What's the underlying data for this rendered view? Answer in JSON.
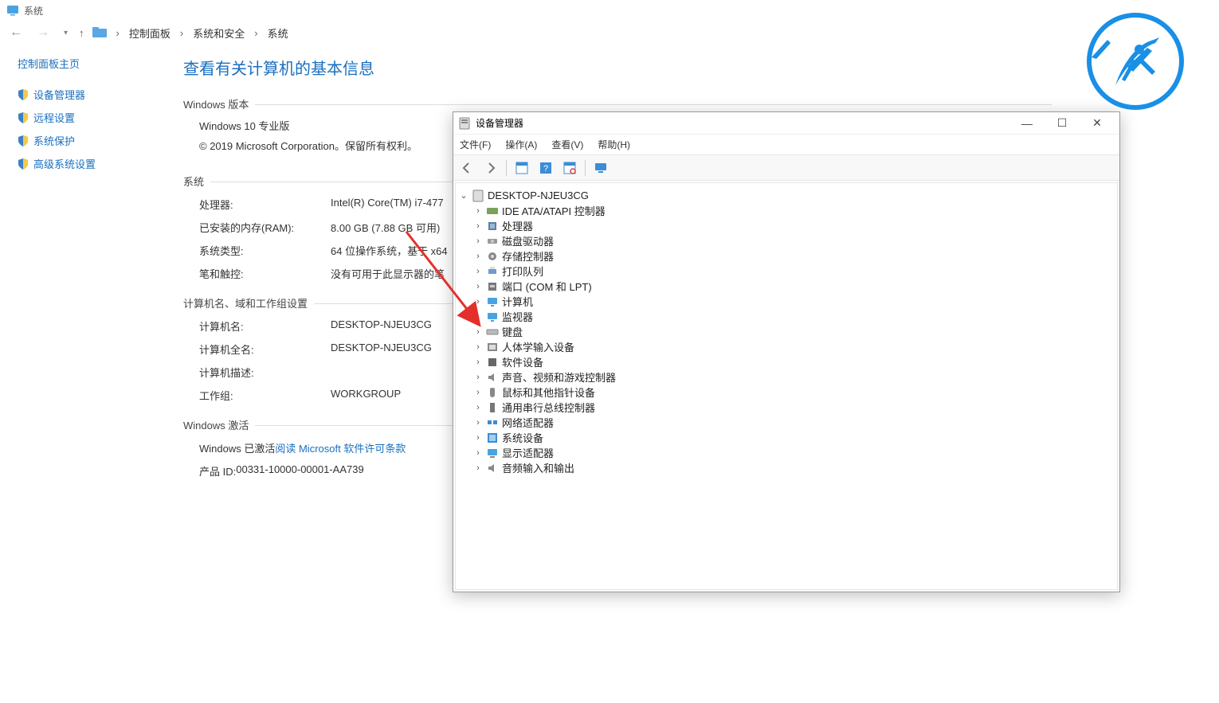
{
  "window": {
    "title": "系统"
  },
  "breadcrumb": {
    "items": [
      "控制面板",
      "系统和安全",
      "系统"
    ]
  },
  "sidebar": {
    "home": "控制面板主页",
    "items": [
      {
        "label": "设备管理器"
      },
      {
        "label": "远程设置"
      },
      {
        "label": "系统保护"
      },
      {
        "label": "高级系统设置"
      }
    ]
  },
  "main": {
    "title": "查看有关计算机的基本信息",
    "windows_section_label": "Windows 版本",
    "windows_edition": "Windows 10 专业版",
    "copyright": "© 2019 Microsoft Corporation。保留所有权利。",
    "system_section_label": "系统",
    "system_rows": [
      {
        "key": "处理器:",
        "val": "Intel(R) Core(TM) i7-477"
      },
      {
        "key": "已安装的内存(RAM):",
        "val": "8.00 GB (7.88 GB 可用)"
      },
      {
        "key": "系统类型:",
        "val": "64 位操作系统，基于 x64"
      },
      {
        "key": "笔和触控:",
        "val": "没有可用于此显示器的笔"
      }
    ],
    "domain_section_label": "计算机名、域和工作组设置",
    "domain_rows": [
      {
        "key": "计算机名:",
        "val": "DESKTOP-NJEU3CG"
      },
      {
        "key": "计算机全名:",
        "val": "DESKTOP-NJEU3CG"
      },
      {
        "key": "计算机描述:",
        "val": ""
      },
      {
        "key": "工作组:",
        "val": "WORKGROUP"
      }
    ],
    "activation_section_label": "Windows 激活",
    "activation_status_prefix": "Windows 已激活 ",
    "activation_link": "阅读 Microsoft 软件许可条款",
    "product_id_label": "产品 ID: ",
    "product_id": "00331-10000-00001-AA739"
  },
  "dm": {
    "title": "设备管理器",
    "menu": [
      "文件(F)",
      "操作(A)",
      "查看(V)",
      "帮助(H)"
    ],
    "root": "DESKTOP-NJEU3CG",
    "nodes": [
      {
        "icon": "ide",
        "label": "IDE ATA/ATAPI 控制器"
      },
      {
        "icon": "chip",
        "label": "处理器"
      },
      {
        "icon": "disk",
        "label": "磁盘驱动器"
      },
      {
        "icon": "gear",
        "label": "存储控制器"
      },
      {
        "icon": "printer",
        "label": "打印队列"
      },
      {
        "icon": "port",
        "label": "端口 (COM 和 LPT)"
      },
      {
        "icon": "monitor",
        "label": "计算机"
      },
      {
        "icon": "monitor",
        "label": "监视器"
      },
      {
        "icon": "kbd",
        "label": "键盘"
      },
      {
        "icon": "hid",
        "label": "人体学输入设备"
      },
      {
        "icon": "soft",
        "label": "软件设备"
      },
      {
        "icon": "speaker",
        "label": "声音、视频和游戏控制器"
      },
      {
        "icon": "mouse",
        "label": "鼠标和其他指针设备"
      },
      {
        "icon": "usb",
        "label": "通用串行总线控制器"
      },
      {
        "icon": "net",
        "label": "网络适配器"
      },
      {
        "icon": "sys",
        "label": "系统设备"
      },
      {
        "icon": "display",
        "label": "显示适配器"
      },
      {
        "icon": "speaker",
        "label": "音频输入和输出"
      }
    ]
  }
}
